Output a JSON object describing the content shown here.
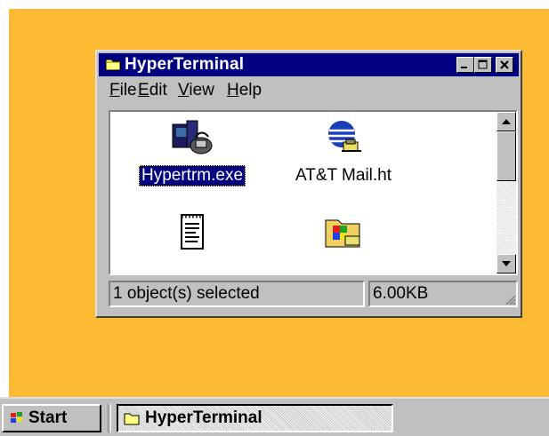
{
  "window": {
    "title": "HyperTerminal",
    "menu": [
      "File",
      "Edit",
      "View",
      "Help"
    ]
  },
  "files": [
    {
      "label": "Hypertrm.exe",
      "icon": "hyperterminal-app-icon",
      "selected": true
    },
    {
      "label": "AT&T Mail.ht",
      "icon": "globe-phone-icon",
      "selected": false
    },
    {
      "label": "",
      "icon": "text-document-icon",
      "selected": false
    },
    {
      "label": "",
      "icon": "program-folder-icon",
      "selected": false
    }
  ],
  "status": {
    "selection": "1 object(s) selected",
    "size": "6.00KB"
  },
  "taskbar": {
    "start_label": "Start",
    "task_label": "HyperTerminal"
  },
  "colors": {
    "desktop": "#fdbb33",
    "title_bar": "#000080",
    "selection": "#000080",
    "chrome": "#c0c0c0"
  }
}
